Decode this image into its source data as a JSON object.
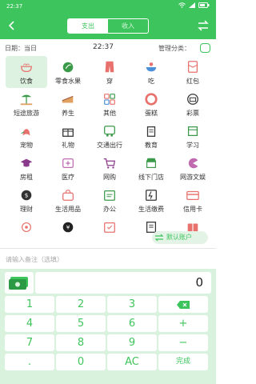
{
  "status": {
    "time": "22:37"
  },
  "header": {
    "tab_expense": "支出",
    "tab_income": "收入"
  },
  "info": {
    "date": "日期：当日",
    "time": "22:37",
    "manage": "管理分类："
  },
  "categories": [
    {
      "label": "饮食",
      "icon": "bowl-icon",
      "color": "#e8716e"
    },
    {
      "label": "零食水果",
      "icon": "fruit-icon",
      "color": "#3b9a4a"
    },
    {
      "label": "穿",
      "icon": "pants-icon",
      "color": "#e8716e"
    },
    {
      "label": "吃",
      "icon": "noodle-icon",
      "color": "#4a90d9"
    },
    {
      "label": "红包",
      "icon": "red-envelope-icon",
      "color": "#e8716e"
    },
    {
      "label": "短途旅游",
      "icon": "beach-icon",
      "color": "#3b9a4a"
    },
    {
      "label": "养生",
      "icon": "cake-slice-icon",
      "color": "#e0a060"
    },
    {
      "label": "其他",
      "icon": "apps-icon",
      "color": "#e8716e"
    },
    {
      "label": "蛋糕",
      "icon": "lifebuoy-icon",
      "color": "#e8716e"
    },
    {
      "label": "彩票",
      "icon": "lottery-icon",
      "color": "#333333"
    },
    {
      "label": "宠物",
      "icon": "pet-icon",
      "color": "#e8716e"
    },
    {
      "label": "礼物",
      "icon": "gift-icon",
      "color": "#333333"
    },
    {
      "label": "交通出行",
      "icon": "car-icon",
      "color": "#3b9a4a"
    },
    {
      "label": "教育",
      "icon": "graduation-icon",
      "color": "#333333"
    },
    {
      "label": "学习",
      "icon": "book-icon",
      "color": "#3b9a4a"
    },
    {
      "label": "房租",
      "icon": "cap-icon",
      "color": "#8a3a8a"
    },
    {
      "label": "医疗",
      "icon": "medical-icon",
      "color": "#c06ab0"
    },
    {
      "label": "网购",
      "icon": "cart-icon",
      "color": "#8a3a8a"
    },
    {
      "label": "线下门店",
      "icon": "store-icon",
      "color": "#3b9a4a"
    },
    {
      "label": "网游文娱",
      "icon": "pacman-icon",
      "color": "#c06ab0"
    },
    {
      "label": "理财",
      "icon": "finance-icon",
      "color": "#333333"
    },
    {
      "label": "生活用品",
      "icon": "bag-icon",
      "color": "#e8716e"
    },
    {
      "label": "办公",
      "icon": "office-icon",
      "color": "#3b9a4a"
    },
    {
      "label": "生活缴费",
      "icon": "bill-icon",
      "color": "#333333"
    },
    {
      "label": "信用卡",
      "icon": "card-icon",
      "color": "#e8716e"
    },
    {
      "label": "",
      "icon": "target-icon",
      "color": "#e8716e"
    },
    {
      "label": "",
      "icon": "yen-icon",
      "color": "#222222"
    },
    {
      "label": "",
      "icon": "calendar-icon",
      "color": "#e8716e"
    },
    {
      "label": "",
      "icon": "receipt-icon",
      "color": "#333333"
    },
    {
      "label": "",
      "icon": "gift-box-icon",
      "color": "#e8716e"
    }
  ],
  "account": {
    "label": "默认账户"
  },
  "note": {
    "placeholder": "请输入备注（选填）"
  },
  "amount": {
    "value": "0"
  },
  "keys": {
    "k1": "1",
    "k2": "2",
    "k3": "3",
    "kdel": "⌫",
    "k4": "4",
    "k5": "5",
    "k6": "6",
    "kplus": "+",
    "k7": "7",
    "k8": "8",
    "k9": "9",
    "kminus": "−",
    "kdot": ".",
    "k0": "0",
    "kac": "AC",
    "kdone": "完成"
  },
  "colors": {
    "accent": "#3dc45c",
    "keypad_bg": "#d9f2dd"
  }
}
